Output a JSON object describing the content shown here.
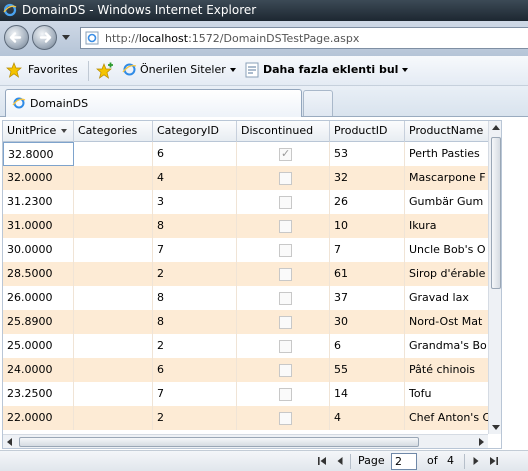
{
  "window": {
    "title": "DomainDS - Windows Internet Explorer"
  },
  "address_bar": {
    "url_prefix": "http://",
    "url_host": "localhost",
    "url_rest": ":1572/DomainDSTestPage.aspx"
  },
  "favorites_bar": {
    "favorites_label": "Favorites",
    "suggested_sites_label": "Önerilen Siteler",
    "more_addons_label": "Daha fazla eklenti bul"
  },
  "tabs": [
    {
      "label": "DomainDS"
    }
  ],
  "grid": {
    "columns": [
      "UnitPrice",
      "Categories",
      "CategoryID",
      "Discontinued",
      "ProductID",
      "ProductName"
    ],
    "sorted_column": "UnitPrice",
    "rows": [
      {
        "unit_price": "32.8000",
        "categories": "",
        "category_id": "6",
        "discontinued": true,
        "product_id": "53",
        "product_name": "Perth Pasties"
      },
      {
        "unit_price": "32.0000",
        "categories": "",
        "category_id": "4",
        "discontinued": false,
        "product_id": "32",
        "product_name": "Mascarpone F"
      },
      {
        "unit_price": "31.2300",
        "categories": "",
        "category_id": "3",
        "discontinued": false,
        "product_id": "26",
        "product_name": "Gumbär Gum"
      },
      {
        "unit_price": "31.0000",
        "categories": "",
        "category_id": "8",
        "discontinued": false,
        "product_id": "10",
        "product_name": "Ikura"
      },
      {
        "unit_price": "30.0000",
        "categories": "",
        "category_id": "7",
        "discontinued": false,
        "product_id": "7",
        "product_name": "Uncle Bob's O"
      },
      {
        "unit_price": "28.5000",
        "categories": "",
        "category_id": "2",
        "discontinued": false,
        "product_id": "61",
        "product_name": "Sirop d'érable"
      },
      {
        "unit_price": "26.0000",
        "categories": "",
        "category_id": "8",
        "discontinued": false,
        "product_id": "37",
        "product_name": "Gravad lax"
      },
      {
        "unit_price": "25.8900",
        "categories": "",
        "category_id": "8",
        "discontinued": false,
        "product_id": "30",
        "product_name": "Nord-Ost Mat"
      },
      {
        "unit_price": "25.0000",
        "categories": "",
        "category_id": "2",
        "discontinued": false,
        "product_id": "6",
        "product_name": "Grandma's Bo"
      },
      {
        "unit_price": "24.0000",
        "categories": "",
        "category_id": "6",
        "discontinued": false,
        "product_id": "55",
        "product_name": "Pâté chinois"
      },
      {
        "unit_price": "23.2500",
        "categories": "",
        "category_id": "7",
        "discontinued": false,
        "product_id": "14",
        "product_name": "Tofu"
      },
      {
        "unit_price": "22.0000",
        "categories": "",
        "category_id": "2",
        "discontinued": false,
        "product_id": "4",
        "product_name": "Chef Anton's C"
      }
    ]
  },
  "pager": {
    "page_label": "Page",
    "current_page": "2",
    "of_label": "of",
    "total_pages": "4"
  },
  "colors": {
    "row_alt": "#fdebd5",
    "titlebar": "#1d2731",
    "accent": "#3a7bd5"
  }
}
